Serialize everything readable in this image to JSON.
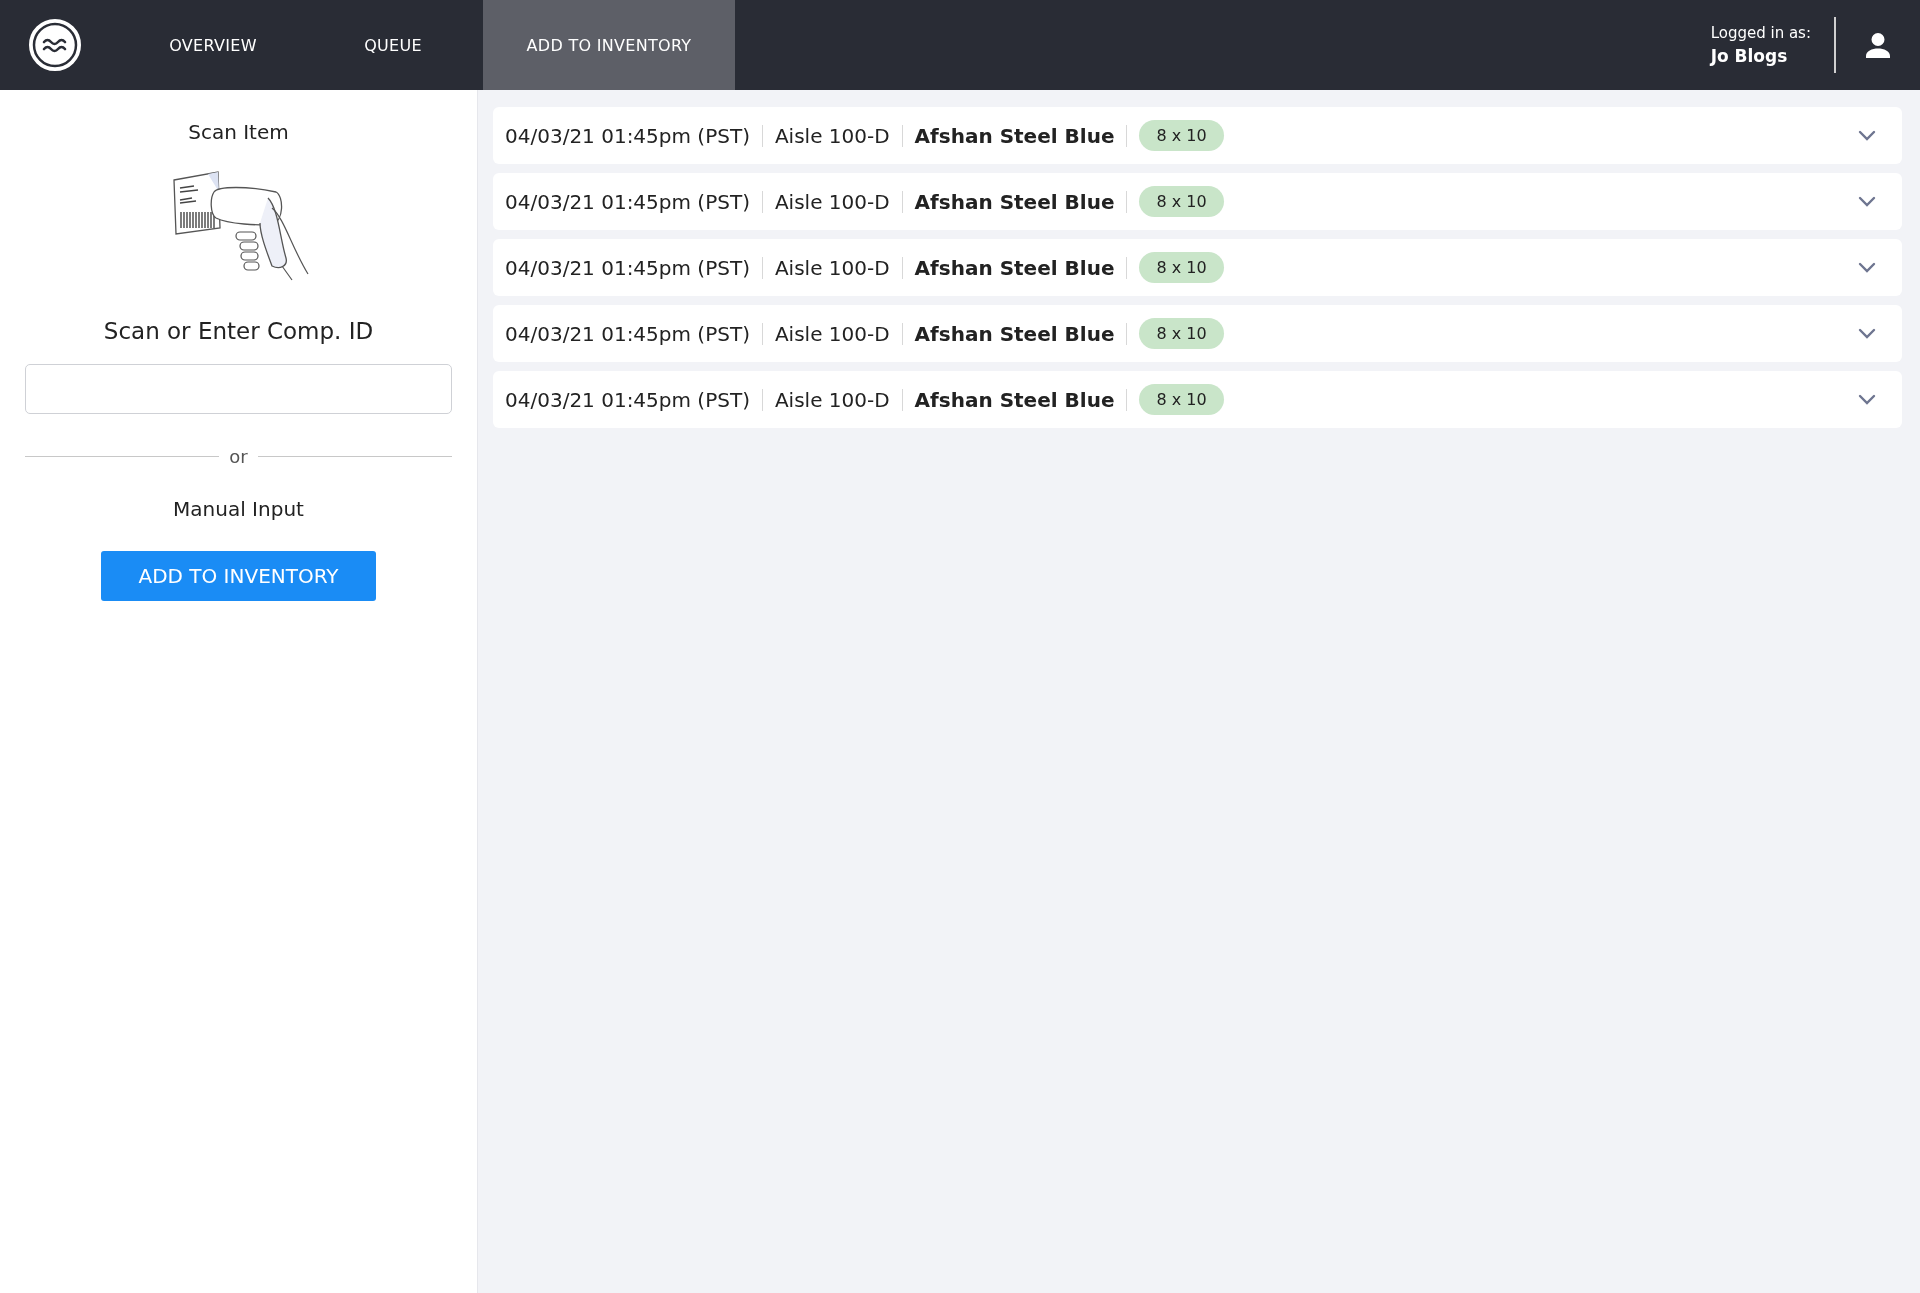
{
  "nav": {
    "tabs": [
      {
        "label": "OVERVIEW",
        "selected": false
      },
      {
        "label": "QUEUE",
        "selected": false
      },
      {
        "label": "ADD TO INVENTORY",
        "selected": true
      }
    ],
    "user": {
      "caption": "Logged in as:",
      "name": "Jo Blogs"
    }
  },
  "scan_panel": {
    "title": "Scan Item",
    "field_label": "Scan or Enter Comp. ID",
    "separator": "or",
    "manual_label": "Manual Input",
    "button": "ADD TO INVENTORY"
  },
  "items": [
    {
      "timestamp": "04/03/21 01:45pm (PST)",
      "location": "Aisle 100-D",
      "name": "Afshan Steel Blue",
      "size": "8 x 10"
    },
    {
      "timestamp": "04/03/21 01:45pm (PST)",
      "location": "Aisle 100-D",
      "name": "Afshan Steel Blue",
      "size": "8 x 10"
    },
    {
      "timestamp": "04/03/21 01:45pm (PST)",
      "location": "Aisle 100-D",
      "name": "Afshan Steel Blue",
      "size": "8 x 10"
    },
    {
      "timestamp": "04/03/21 01:45pm (PST)",
      "location": "Aisle 100-D",
      "name": "Afshan Steel Blue",
      "size": "8 x 10"
    },
    {
      "timestamp": "04/03/21 01:45pm (PST)",
      "location": "Aisle 100-D",
      "name": "Afshan Steel Blue",
      "size": "8 x 10"
    }
  ]
}
